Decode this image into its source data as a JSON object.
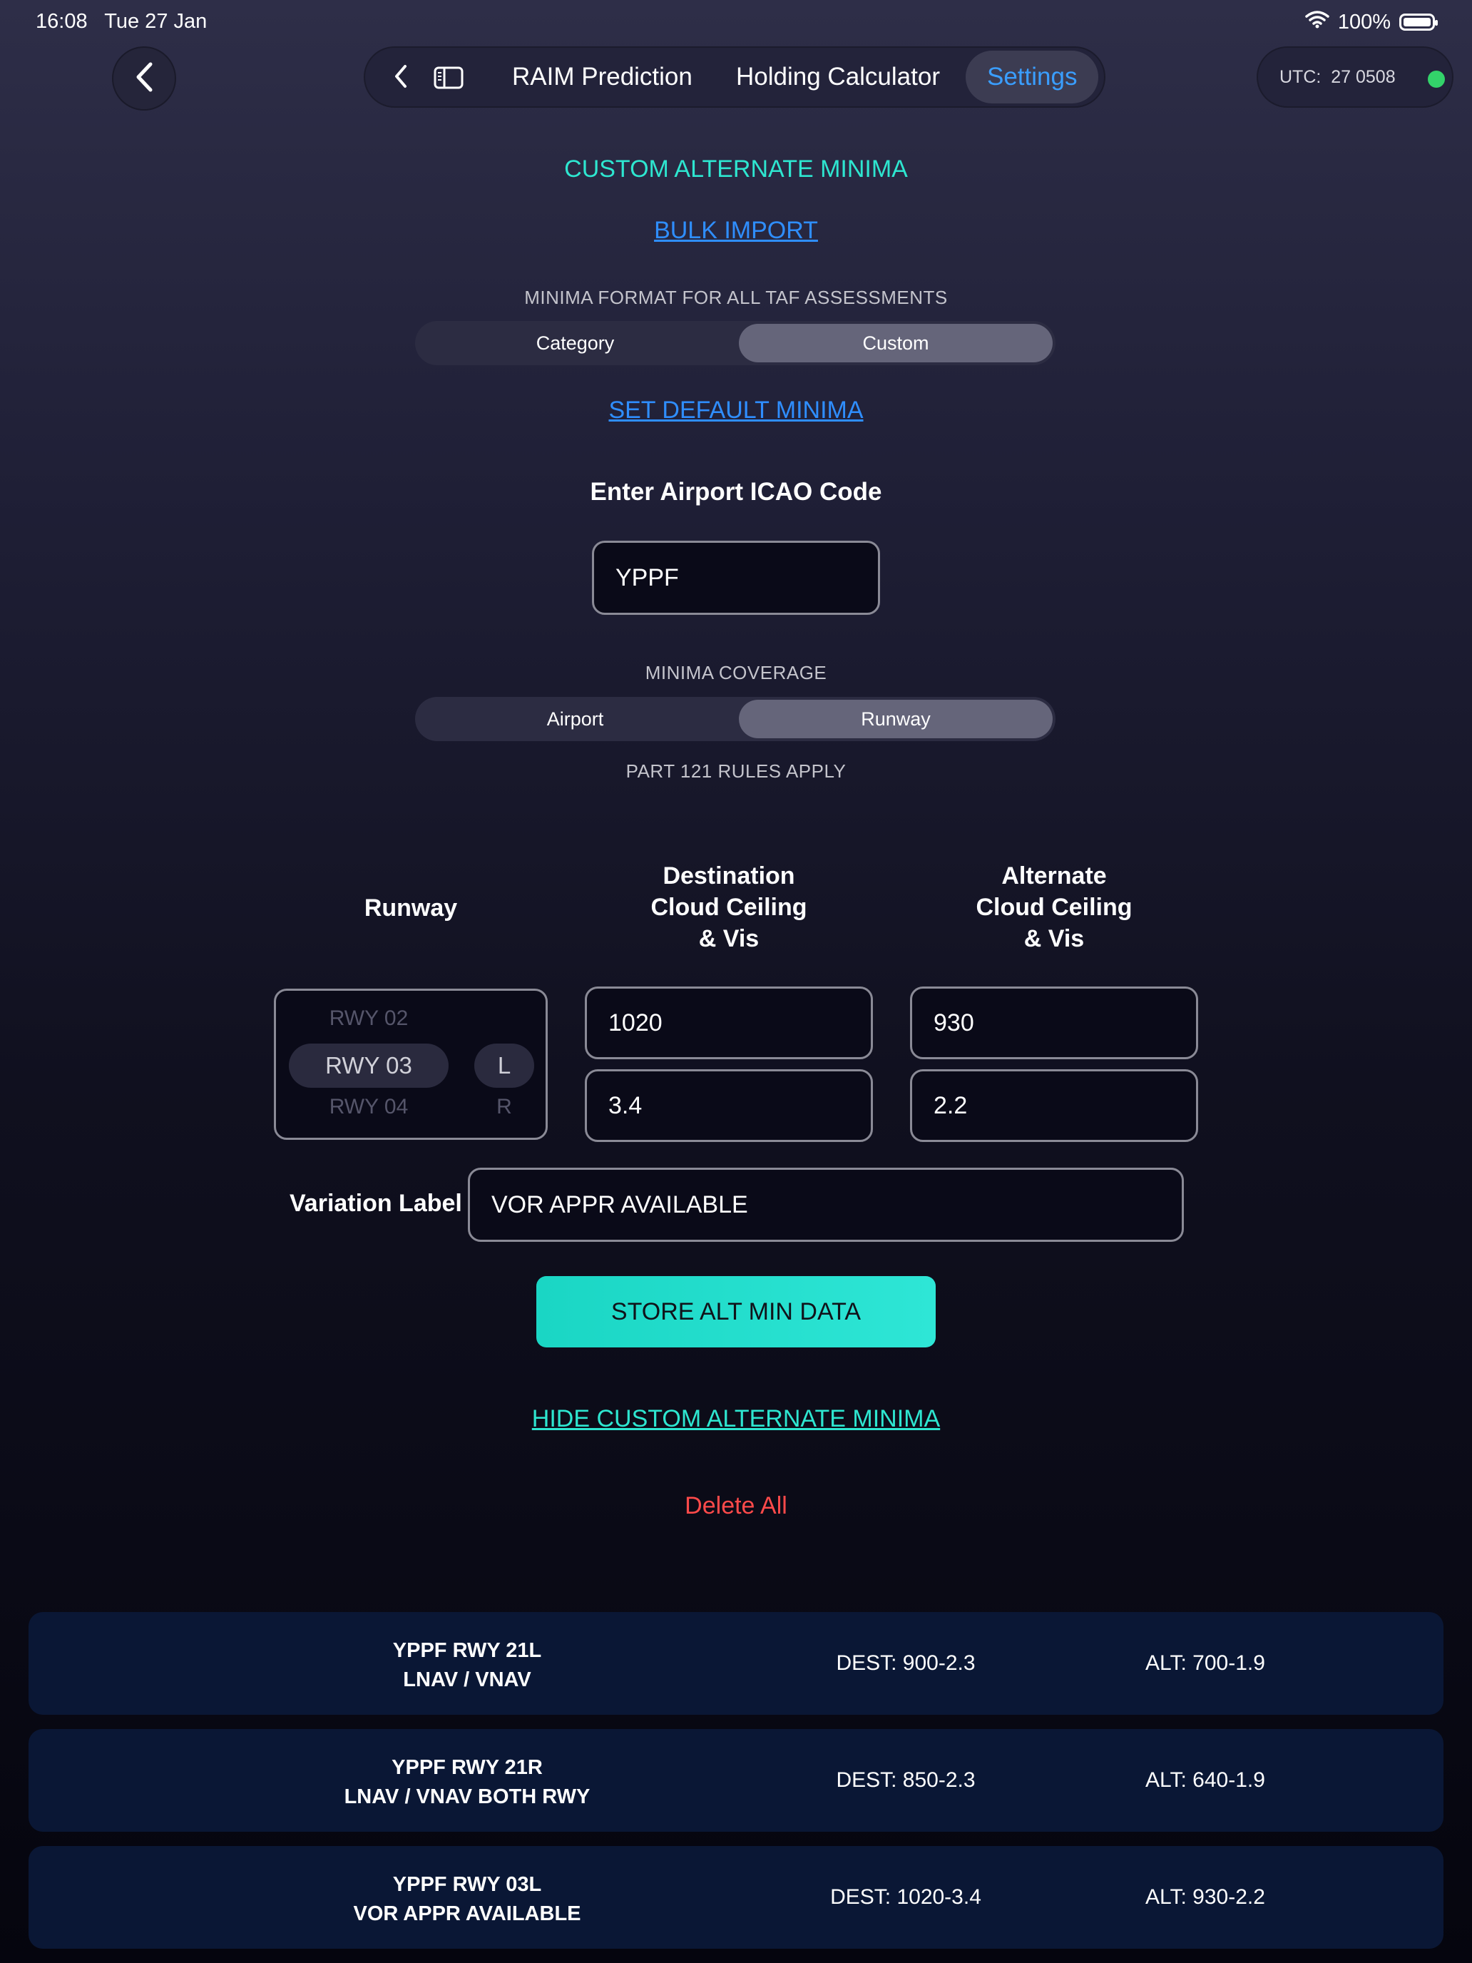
{
  "status_bar": {
    "time": "16:08",
    "date": "Tue 27 Jan",
    "battery": "100%"
  },
  "nav": {
    "tabs": [
      {
        "label": "RAIM Prediction"
      },
      {
        "label": "Holding Calculator"
      },
      {
        "label": "Settings",
        "active": true
      }
    ],
    "utc_label": "UTC:",
    "utc_value": "27 0508"
  },
  "section_title": "CUSTOM ALTERNATE MINIMA",
  "bulk_import_label": "BULK IMPORT",
  "minima_format": {
    "caption": "MINIMA FORMAT FOR ALL TAF ASSESSMENTS",
    "options": [
      "Category",
      "Custom"
    ],
    "selected": "Custom"
  },
  "set_default_label": "SET DEFAULT MINIMA",
  "icao": {
    "label": "Enter Airport ICAO Code",
    "value": "YPPF"
  },
  "coverage": {
    "caption": "MINIMA COVERAGE",
    "options": [
      "Airport",
      "Runway"
    ],
    "selected": "Runway",
    "rules_note": "PART 121 RULES APPLY"
  },
  "columns": {
    "runway": "Runway",
    "dest": [
      "Destination",
      "Cloud Ceiling",
      "& Vis"
    ],
    "alt": [
      "Alternate",
      "Cloud Ceiling",
      "& Vis"
    ]
  },
  "runway_picker": {
    "prev": "RWY 02",
    "selected": "RWY 03",
    "next": "RWY 04",
    "side_selected": "L",
    "side_next": "R"
  },
  "inputs": {
    "dest_ceiling": "1020",
    "dest_vis": "3.4",
    "alt_ceiling": "930",
    "alt_vis": "2.2"
  },
  "variation": {
    "label": "Variation Label",
    "value": "VOR APPR AVAILABLE"
  },
  "store_button": "STORE ALT MIN DATA",
  "hide_link": "HIDE CUSTOM ALTERNATE MINIMA",
  "delete_all": "Delete All",
  "saved_minima": [
    {
      "line1": "YPPF RWY 21L",
      "line2": "LNAV / VNAV",
      "dest": "DEST: 900-2.3",
      "alt": "ALT: 700-1.9"
    },
    {
      "line1": "YPPF RWY 21R",
      "line2": "LNAV / VNAV BOTH RWY",
      "dest": "DEST: 850-2.3",
      "alt": "ALT: 640-1.9"
    },
    {
      "line1": "YPPF RWY 03L",
      "line2": "VOR APPR AVAILABLE",
      "dest": "DEST: 1020-3.4",
      "alt": "ALT: 930-2.2"
    }
  ]
}
